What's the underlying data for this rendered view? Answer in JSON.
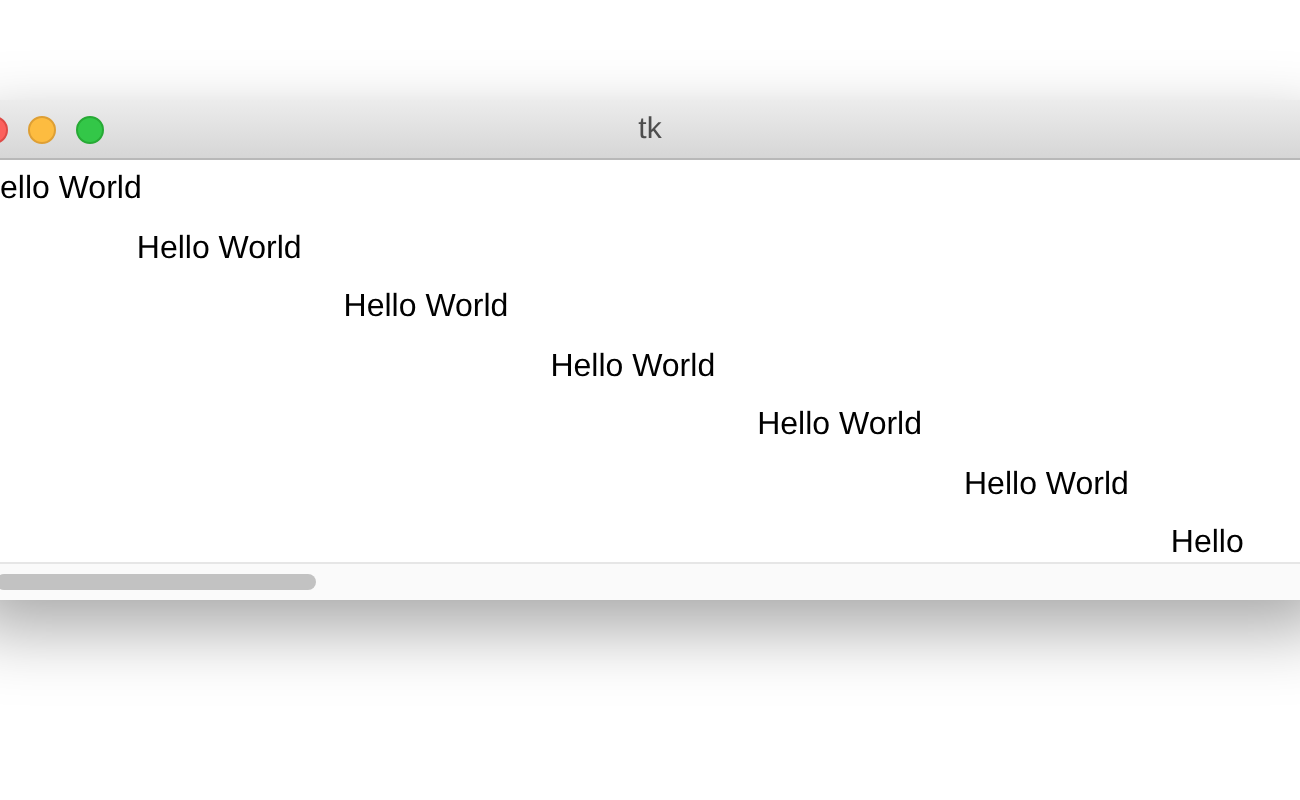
{
  "window": {
    "title": "tk"
  },
  "canvas": {
    "texts": [
      "ello World",
      "Hello World",
      "Hello World",
      "Hello World",
      "Hello World",
      "Hello World",
      "Hello"
    ]
  }
}
